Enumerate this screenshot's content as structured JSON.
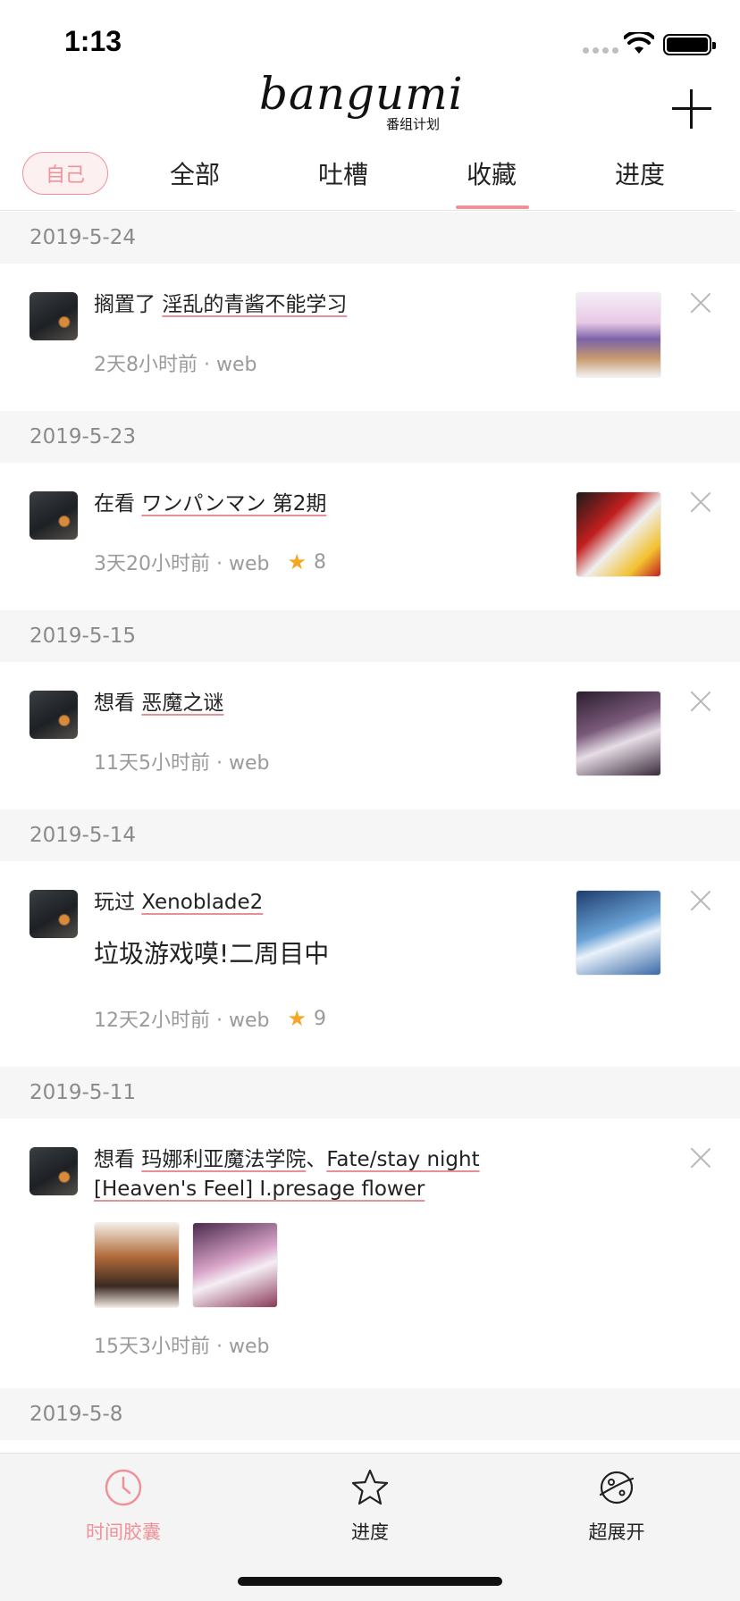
{
  "status_bar": {
    "time": "1:13"
  },
  "header": {
    "logo_text": "bangumi",
    "logo_subtitle": "番组计划"
  },
  "tabs": {
    "self_chip": "自己",
    "items": [
      {
        "label": "全部"
      },
      {
        "label": "吐槽"
      },
      {
        "label": "收藏"
      },
      {
        "label": "进度"
      }
    ],
    "active_index": 2
  },
  "colors": {
    "accent": "#f09199",
    "star": "#f5a623",
    "date_bg": "#f6f6f6",
    "meta_text": "#9a9a9a"
  },
  "feed": [
    {
      "date": "2019-5-24",
      "action": "搁置了",
      "subjects": [
        "淫乱的青酱不能学习"
      ],
      "time": "2天8小时前 · web",
      "rating": null
    },
    {
      "date": "2019-5-23",
      "action": "在看",
      "subjects": [
        "ワンパンマン 第2期"
      ],
      "time": "3天20小时前 · web",
      "rating": "8"
    },
    {
      "date": "2019-5-15",
      "action": "想看",
      "subjects": [
        "恶魔之谜"
      ],
      "time": "11天5小时前 · web",
      "rating": null
    },
    {
      "date": "2019-5-14",
      "action": "玩过",
      "subjects": [
        "Xenoblade2"
      ],
      "comment": "垃圾游戏嗼!二周目中",
      "time": "12天2小时前 · web",
      "rating": "9"
    },
    {
      "date": "2019-5-11",
      "action": "想看",
      "subjects": [
        "玛娜利亚魔法学院",
        "Fate/stay night [Heaven's Feel] I.presage flower"
      ],
      "separator": "、",
      "time": "15天3小时前 · web",
      "rating": null
    },
    {
      "date": "2019-5-8"
    }
  ],
  "tabbar": {
    "items": [
      {
        "label": "时间胶囊",
        "icon": "clock-icon",
        "active": true
      },
      {
        "label": "进度",
        "icon": "star-icon",
        "active": false
      },
      {
        "label": "超展开",
        "icon": "planet-icon",
        "active": false
      }
    ]
  }
}
